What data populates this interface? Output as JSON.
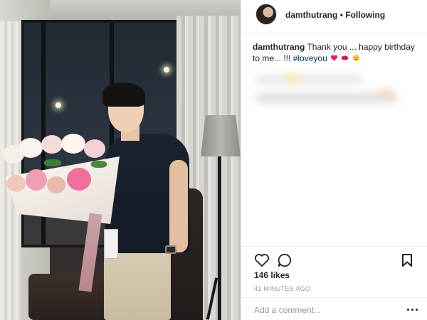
{
  "header": {
    "username": "damthutrang",
    "separator": "•",
    "follow_status": "Following"
  },
  "caption": {
    "username": "damthutrang",
    "text_part1": "Thank you ... happy birthday to me... !!!",
    "hashtag": "#loveyou",
    "emoji_icons": [
      "heart-icon",
      "lips-icon",
      "smile-icon"
    ]
  },
  "engagement": {
    "likes": "146 likes",
    "timestamp": "41 MINUTES AGO"
  },
  "comment": {
    "placeholder": "Add a comment..."
  },
  "icons": {
    "like": "heart-outline-icon",
    "comment": "comment-bubble-icon",
    "save": "bookmark-icon",
    "more": "more-options-icon"
  },
  "colors": {
    "hashtag": "#003569",
    "text": "#262626",
    "muted": "#999999",
    "border": "#efefef"
  }
}
